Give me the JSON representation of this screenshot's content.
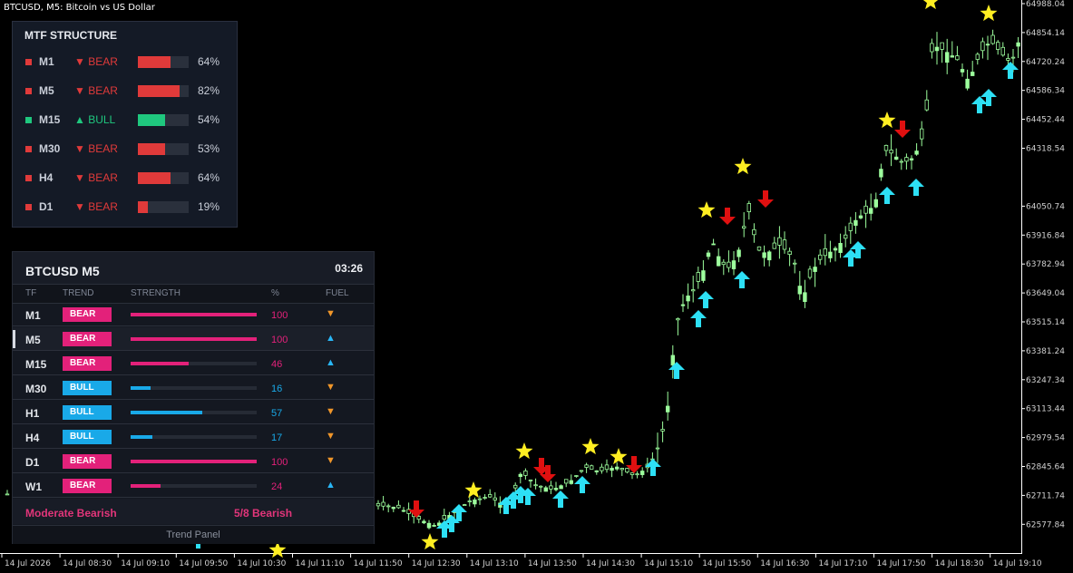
{
  "window": {
    "title": "BTCUSD, M5:  Bitcoin vs US Dollar"
  },
  "colors": {
    "bear_red": "#e03a3a",
    "bull_green": "#1fc77e",
    "bear_badge": "#e3217a",
    "bull_badge": "#19a9e8",
    "candle": "#9dff9d",
    "arrow_up": "#2de0f5",
    "arrow_down": "#e01010",
    "star": "#ffee22"
  },
  "price_axis": [
    "64988.04",
    "64854.14",
    "64720.24",
    "64586.34",
    "64452.44",
    "64318.54",
    "64050.74",
    "63916.84",
    "63782.94",
    "63649.04",
    "63515.14",
    "63381.24",
    "63247.34",
    "63113.44",
    "62979.54",
    "62845.64",
    "62711.74",
    "62577.84"
  ],
  "time_axis": [
    "14 Jul 2026",
    "14 Jul 08:30",
    "14 Jul 09:10",
    "14 Jul 09:50",
    "14 Jul 10:30",
    "14 Jul 11:10",
    "14 Jul 11:50",
    "14 Jul 12:30",
    "14 Jul 13:10",
    "14 Jul 13:50",
    "14 Jul 14:30",
    "14 Jul 15:10",
    "14 Jul 15:50",
    "14 Jul 16:30",
    "14 Jul 17:10",
    "14 Jul 17:50",
    "14 Jul 18:30",
    "14 Jul 19:10"
  ],
  "mtf_structure": {
    "title": "MTF STRUCTURE",
    "rows": [
      {
        "tf": "M1",
        "direction": "▼ BEAR",
        "trend": "bear",
        "percent": 64,
        "percent_label": "64%"
      },
      {
        "tf": "M5",
        "direction": "▼ BEAR",
        "trend": "bear",
        "percent": 82,
        "percent_label": "82%"
      },
      {
        "tf": "M15",
        "direction": "▲ BULL",
        "trend": "bull",
        "percent": 54,
        "percent_label": "54%"
      },
      {
        "tf": "M30",
        "direction": "▼ BEAR",
        "trend": "bear",
        "percent": 53,
        "percent_label": "53%"
      },
      {
        "tf": "H4",
        "direction": "▼ BEAR",
        "trend": "bear",
        "percent": 64,
        "percent_label": "64%"
      },
      {
        "tf": "D1",
        "direction": "▼ BEAR",
        "trend": "bear",
        "percent": 19,
        "percent_label": "19%"
      }
    ]
  },
  "trend_panel": {
    "symbol": "BTCUSD  M5",
    "countdown": "03:26",
    "columns": {
      "tf": "TF",
      "trend": "TREND",
      "strength": "STRENGTH",
      "pct": "%",
      "fuel": "FUEL"
    },
    "rows": [
      {
        "tf": "M1",
        "trend": "BEAR",
        "strength": 100,
        "strength_label": "100",
        "fuel": "▼",
        "fuel_dir": "down"
      },
      {
        "tf": "M5",
        "trend": "BEAR",
        "strength": 100,
        "strength_label": "100",
        "fuel": "▲",
        "fuel_dir": "up"
      },
      {
        "tf": "M15",
        "trend": "BEAR",
        "strength": 46,
        "strength_label": "46",
        "fuel": "▲",
        "fuel_dir": "up"
      },
      {
        "tf": "M30",
        "trend": "BULL",
        "strength": 16,
        "strength_label": "16",
        "fuel": "▼",
        "fuel_dir": "down"
      },
      {
        "tf": "H1",
        "trend": "BULL",
        "strength": 57,
        "strength_label": "57",
        "fuel": "▼",
        "fuel_dir": "down"
      },
      {
        "tf": "H4",
        "trend": "BULL",
        "strength": 17,
        "strength_label": "17",
        "fuel": "▼",
        "fuel_dir": "down"
      },
      {
        "tf": "D1",
        "trend": "BEAR",
        "strength": 100,
        "strength_label": "100",
        "fuel": "▼",
        "fuel_dir": "down"
      },
      {
        "tf": "W1",
        "trend": "BEAR",
        "strength": 24,
        "strength_label": "24",
        "fuel": "▲",
        "fuel_dir": "up"
      }
    ],
    "summary": "Moderate Bearish",
    "count": "5/8 Bearish",
    "footer_label": "Trend Panel"
  }
}
